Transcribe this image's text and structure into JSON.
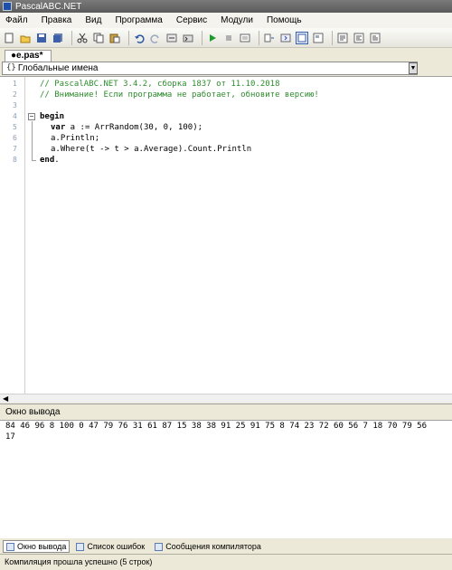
{
  "window": {
    "title": "PascalABC.NET"
  },
  "menu": [
    "Файл",
    "Правка",
    "Вид",
    "Программа",
    "Сервис",
    "Модули",
    "Помощь"
  ],
  "toolbar": {
    "icons": [
      "new-file-icon",
      "open-folder-icon",
      "save-icon",
      "save-all-icon",
      "cut-icon",
      "copy-icon",
      "paste-icon",
      "undo-icon",
      "redo-icon",
      "find-icon",
      "run-icon",
      "stop-icon",
      "debug-icon",
      "step-into-icon",
      "step-over-icon",
      "output-window-icon",
      "panel-icon",
      "form-designer-icon",
      "module-icon"
    ]
  },
  "editor": {
    "tab_label": "●e.pas*",
    "scope_label": "Глобальные имена",
    "scope_icon": "{}",
    "line_numbers": [
      "1",
      "2",
      "3",
      "4",
      "5",
      "6",
      "7",
      "8"
    ],
    "lines": {
      "l1": "// PascalABC.NET 3.4.2, сборка 1837 от 11.10.2018",
      "l2": "// Внимание! Если программа не работает, обновите версию!",
      "l4_kw": "begin",
      "l5_kw": "var",
      "l5_a": " a := ArrRandom(",
      "l5_n1": "30",
      "l5_b": ", ",
      "l5_n2": "0",
      "l5_c": ", ",
      "l5_n3": "100",
      "l5_d": ");",
      "l6": "a.Println;",
      "l7": "a.Where(t -> t > a.Average).Count.Println",
      "l8_kw": "end",
      "l8_dot": "."
    }
  },
  "output": {
    "header": "Окно вывода",
    "line1": "84 46 96 8 100 0 47 79 76 31 61 87 15 38 38 91 25 91 75 8 74 23 72 60 56 7 18 70 79 56",
    "line2": "17"
  },
  "bottom_tabs": [
    "Окно вывода",
    "Список ошибок",
    "Сообщения компилятора"
  ],
  "status": "Компиляция прошла успешно (5 строк)"
}
